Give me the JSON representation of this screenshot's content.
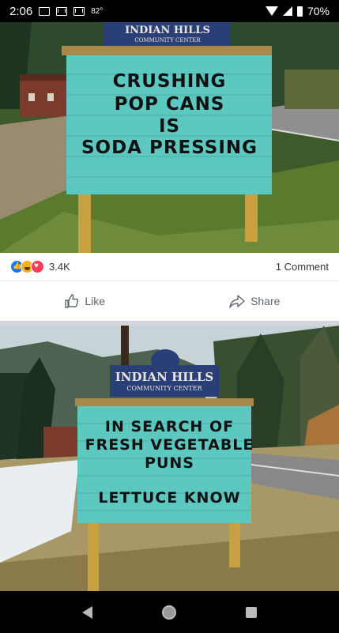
{
  "status_bar": {
    "time": "2:06",
    "temperature": "82°",
    "battery": "70%",
    "icons": [
      "image-icon",
      "gmail-icon",
      "gmail-icon",
      "wifi-icon",
      "signal-icon",
      "battery-icon"
    ]
  },
  "post1": {
    "board_header_line1": "INDIAN HILLS",
    "board_header_line2": "COMMUNITY CENTER",
    "sign_lines": [
      "CRUSHING",
      "POP CANS",
      "IS",
      "SODA PRESSING"
    ]
  },
  "reactions": {
    "icons": [
      "like-reaction",
      "haha-reaction",
      "love-reaction"
    ],
    "count": "3.4K",
    "comments": "1 Comment"
  },
  "actions": {
    "like_label": "Like",
    "share_label": "Share"
  },
  "post2": {
    "board_header_line1": "INDIAN HILLS",
    "board_header_line2": "COMMUNITY CENTER",
    "sign_lines": [
      "IN SEARCH OF",
      "FRESH VEGETABLE",
      "PUNS",
      "LETTUCE KNOW"
    ]
  },
  "colors": {
    "sign_teal": "#5cc8c0",
    "sign_header_blue": "#2a3f78",
    "post_wood": "#c9a040",
    "facebook_blue": "#1877f2"
  }
}
